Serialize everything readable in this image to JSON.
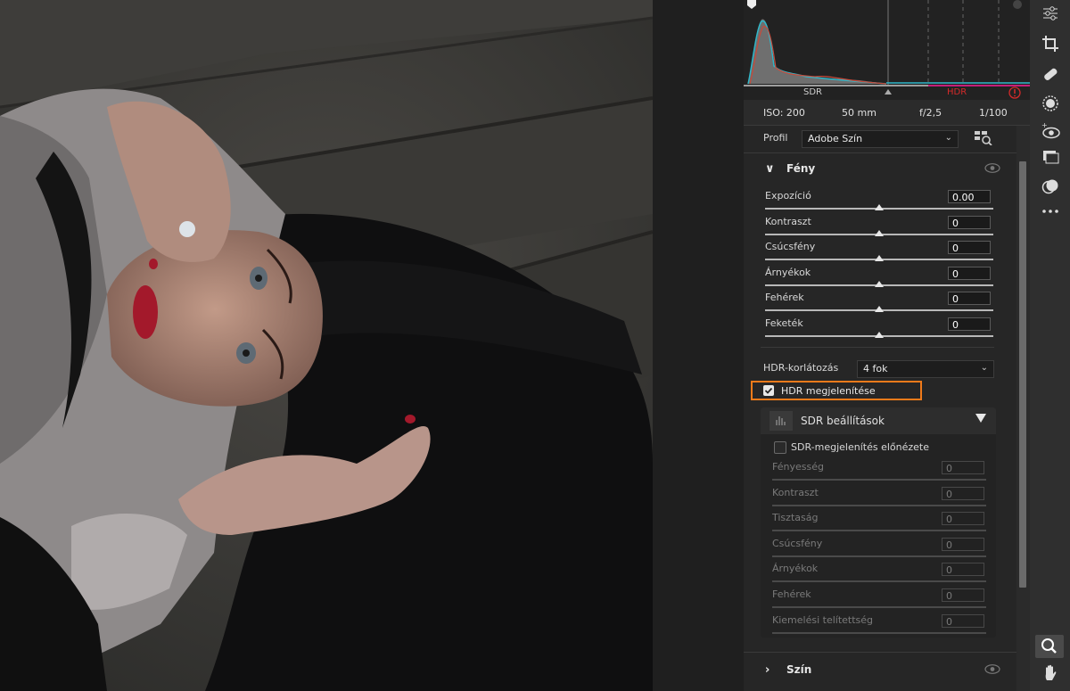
{
  "histogram": {
    "sdr_label": "SDR",
    "hdr_label": "HDR",
    "warning_icon": "clipping-warning-icon",
    "hdr_color": "#d42a2a"
  },
  "camera_info": {
    "iso": "ISO: 200",
    "focal": "50 mm",
    "aperture": "f/2,5",
    "shutter": "1/100"
  },
  "profile": {
    "label": "Profil",
    "value": "Adobe Szín",
    "browse_icon": "profile-browser-icon"
  },
  "light_section": {
    "title": "Fény",
    "sliders": [
      {
        "label": "Expozíció",
        "value": "0.00",
        "position": 0.5
      },
      {
        "label": "Kontraszt",
        "value": "0",
        "position": 0.5
      },
      {
        "label": "Csúcsfény",
        "value": "0",
        "position": 0.5
      },
      {
        "label": "Árnyékok",
        "value": "0",
        "position": 0.5
      },
      {
        "label": "Fehérek",
        "value": "0",
        "position": 0.5
      },
      {
        "label": "Feketék",
        "value": "0",
        "position": 0.5
      }
    ],
    "hdr_limit_label": "HDR-korlátozás",
    "hdr_limit_value": "4 fok",
    "hdr_display_label": "HDR megjelenítése",
    "hdr_display_checked": true,
    "highlight_color": "#ef7a1a"
  },
  "sdr_settings": {
    "title": "SDR beállítások",
    "preview_label": "SDR-megjelenítés előnézete",
    "preview_checked": false,
    "sliders": [
      {
        "label": "Fényesség",
        "value": "0"
      },
      {
        "label": "Kontraszt",
        "value": "0"
      },
      {
        "label": "Tisztaság",
        "value": "0"
      },
      {
        "label": "Csúcsfény",
        "value": "0"
      },
      {
        "label": "Árnyékok",
        "value": "0"
      },
      {
        "label": "Fehérek",
        "value": "0"
      },
      {
        "label": "Kiemelési telítettség",
        "value": "0"
      }
    ]
  },
  "color_section": {
    "title": "Szín"
  },
  "toolbar": {
    "tools": [
      "edit-sliders-icon",
      "crop-icon",
      "healing-icon",
      "masking-icon",
      "red-eye-icon",
      "snapshots-icon",
      "presets-icon",
      "more-icon"
    ],
    "bottom_tools": [
      "zoom-icon",
      "hand-icon"
    ]
  }
}
